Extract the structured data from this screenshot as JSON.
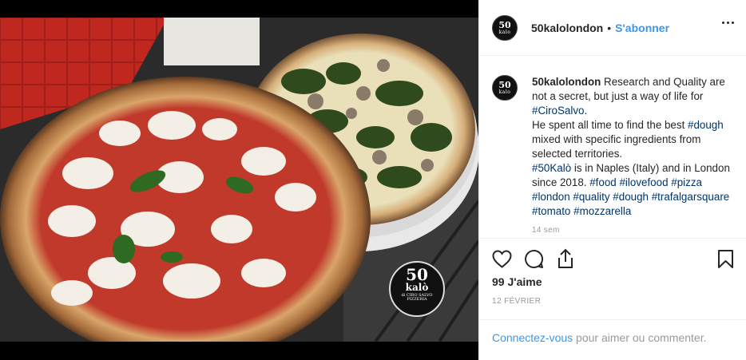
{
  "post": {
    "username": "50kalolondon",
    "separator": "•",
    "follow_label": "S'abonner",
    "avatar": {
      "line1": "50",
      "line2": "kalo"
    },
    "watermark": {
      "line1": "50",
      "line2": "kalò",
      "line3": "di CIRO SALVO",
      "line4": "PIZZERIA"
    }
  },
  "caption": {
    "username": "50kalolondon",
    "part1": " Research and Quality are not a secret, but just a way of life for ",
    "tag_cirosalvo": "#CiroSalvo",
    "part2": ".",
    "part3": "He spent all time to find the best ",
    "tag_dough1": "#dough",
    "part4": " mixed with specific ingredients from selected territories.",
    "tag_50kalo": "#50Kalò",
    "part5": " is in Naples (Italy) and in London since 2018. ",
    "tag_food": "#food",
    "tag_ilovefood": "#ilovefood",
    "tag_pizza": "#pizza",
    "tag_london": "#london",
    "tag_quality": "#quality",
    "tag_dough2": "#dough",
    "tag_trafalgar": "#trafalgarsquare",
    "tag_tomato": "#tomato",
    "tag_mozzarella": "#mozzarella",
    "time_small": "14 sem"
  },
  "actions": {
    "likes": "99 J'aime",
    "date": "12 FÉVRIER",
    "icons": [
      "heart-icon",
      "comment-icon",
      "share-icon",
      "bookmark-icon"
    ]
  },
  "login": {
    "link": "Connectez-vous",
    "text": " pour aimer ou commenter."
  },
  "colors": {
    "link": "#003569",
    "accent": "#3897f0",
    "muted": "#999999"
  }
}
